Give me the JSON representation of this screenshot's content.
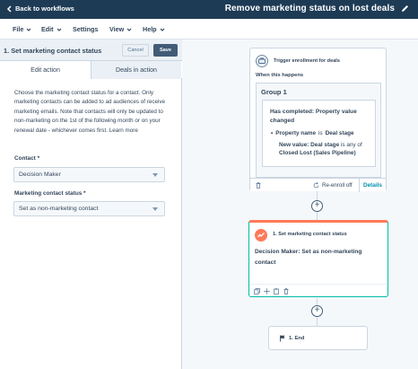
{
  "topbar": {
    "back_label": "Back to workflows",
    "workflow_title": "Remove marketing status on lost deals"
  },
  "menu": {
    "file": "File",
    "edit": "Edit",
    "settings": "Settings",
    "view": "View",
    "help": "Help"
  },
  "panel": {
    "title": "1. Set marketing contact status",
    "cancel_label": "Cancel",
    "save_label": "Save",
    "tabs": [
      "Edit action",
      "Deals in action"
    ],
    "description": "Choose the marketing contact status for a contact. Only marketing contacts can be added to ad audiences of receive marketing emails. Note that contacts will only be updated to non-marketing on the 1st of the following month or on your renewal date - whichever comes first.",
    "learn_more": "Learn more",
    "contact_label": "Contact *",
    "contact_value": "Decision Maker",
    "status_label": "Marketing contact status *",
    "status_value": "Set as non-marketing contact"
  },
  "trigger": {
    "header": "Trigger enrollment for deals",
    "when": "When this happens",
    "group": "Group 1",
    "condition_title": "Has completed: Property value changed",
    "prop_prefix": "Property name",
    "prop_is": "is",
    "prop_value": "Deal stage",
    "new_value_label": "New value: Deal stage",
    "new_value_mid": "is any of",
    "new_value_val": "Closed Lost (Sales Pipeline)",
    "reenroll": "Re-enroll off",
    "details": "Details"
  },
  "action": {
    "header": "1. Set marketing contact status",
    "body_bold": "Decision Maker",
    "body_rest": ": Set as non-marketing contact"
  },
  "end": {
    "label": "1. End"
  },
  "colors": {
    "topbar": "#1e3b55",
    "accent_orange": "#ff7a59",
    "accent_teal": "#00bda5",
    "link": "#0091ae"
  }
}
